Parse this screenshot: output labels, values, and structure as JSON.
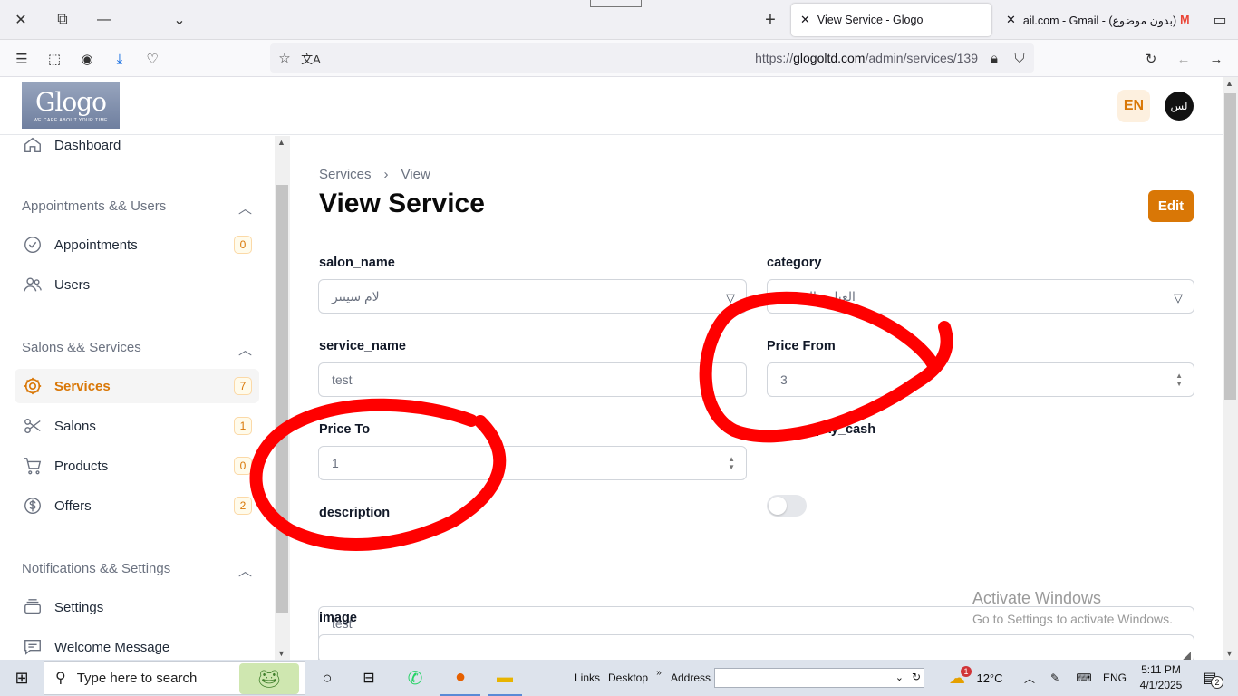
{
  "browser": {
    "tabs": [
      {
        "title": "View Service - Glogo",
        "active": true
      },
      {
        "title": "ail.com - Gmail - (بدون موضوع)",
        "active": false
      }
    ],
    "url_prefix": "https://",
    "url_domain": "glogoltd.com",
    "url_path": "/admin/services/139"
  },
  "header": {
    "logo_text": "Glogo",
    "logo_tagline": "WE CARE ABOUT YOUR TIME",
    "language": "EN",
    "avatar_initials": "لس"
  },
  "sidebar": {
    "dashboard": "Dashboard",
    "groups": [
      {
        "label": "Appointments && Users"
      },
      {
        "label": "Salons && Services"
      },
      {
        "label": "Notifications && Settings"
      }
    ],
    "items": [
      {
        "label": "Appointments",
        "count": "0"
      },
      {
        "label": "Users"
      },
      {
        "label": "Services",
        "count": "7"
      },
      {
        "label": "Salons",
        "count": "1"
      },
      {
        "label": "Products",
        "count": "0"
      },
      {
        "label": "Offers",
        "count": "2"
      },
      {
        "label": "Settings"
      },
      {
        "label": "Welcome Message"
      }
    ]
  },
  "main": {
    "breadcrumb": [
      "Services",
      "View"
    ],
    "title": "View Service",
    "edit_label": "Edit",
    "fields": {
      "salon_name": {
        "label": "salon_name",
        "value": "لام سينتر"
      },
      "category": {
        "label": "category",
        "value": "العناية بالبشرة"
      },
      "service_name": {
        "label": "service_name",
        "value": "test"
      },
      "price_from": {
        "label": "Price From",
        "value": "3"
      },
      "price_to": {
        "label": "Price To",
        "value": "1"
      },
      "pay_cash": {
        "label": "pay_cash"
      },
      "description": {
        "label": "description",
        "value": "test"
      },
      "image": {
        "label": "image"
      }
    },
    "watermark_title": "Activate Windows",
    "watermark_sub": "Go to Settings to activate Windows."
  },
  "taskbar": {
    "search_placeholder": "Type here to search",
    "links": "Links",
    "desktop": "Desktop",
    "address": "Address",
    "temperature": "12°C",
    "weather_badge": "1",
    "language": "ENG",
    "time": "5:11 PM",
    "date": "4/1/2025",
    "notifications": "2"
  },
  "colors": {
    "accent": "#d97706",
    "annotation": "#ff0000"
  }
}
